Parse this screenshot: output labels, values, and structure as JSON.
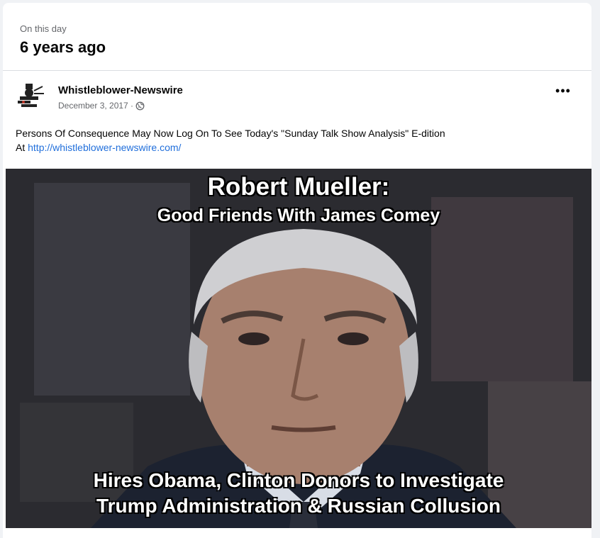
{
  "memory": {
    "eyebrow": "On this day",
    "heading": "6 years ago"
  },
  "post": {
    "page_name": "Whistleblower-Newswire",
    "date": "December 3, 2017 ·",
    "privacy_icon": "globe-icon",
    "more_icon": "more-options-icon",
    "text": "Persons Of Consequence May Now Log On To See Today's \"Sunday Talk Show Analysis\" E-dition",
    "text_prefix_link": "At ",
    "link": "http://whistleblower-newswire.com/",
    "image": {
      "title": "Robert Mueller:",
      "subtitle": "Good Friends With James Comey",
      "caption_line1": "Hires Obama, Clinton Donors to Investigate",
      "caption_line2": "Trump Administration & Russian Collusion"
    }
  },
  "colors": {
    "link": "#216fdb",
    "secondary_text": "#65676b",
    "background": "#f0f2f5"
  }
}
